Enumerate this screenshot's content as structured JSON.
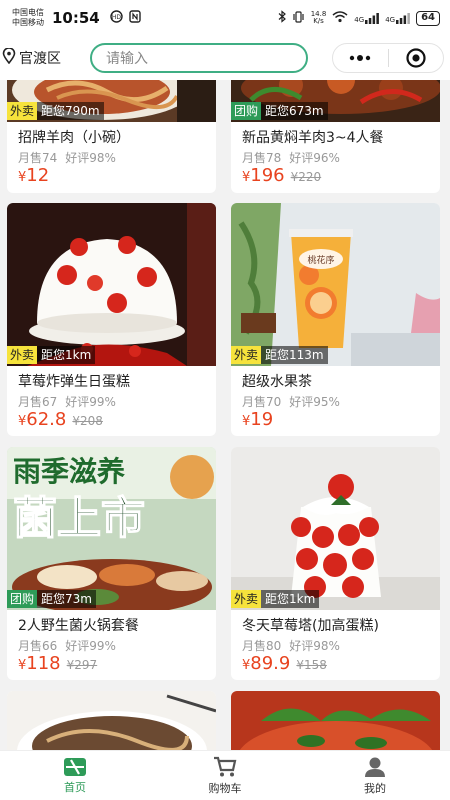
{
  "status": {
    "carrier1": "中国电信",
    "carrier2": "中国移动",
    "time": "10:54",
    "speed_value": "14.8",
    "speed_unit": "K/s",
    "signal1": "4G",
    "signal2": "4G",
    "battery": "64"
  },
  "header": {
    "location": "官渡区",
    "search_placeholder": "请输入"
  },
  "products": [
    {
      "tag": "外卖",
      "distance": "距您790m",
      "name": "招牌羊肉（小碗）",
      "sales": "月售74",
      "rating": "好评98%",
      "yen": "¥",
      "price": "12",
      "old_price": ""
    },
    {
      "tag": "团购",
      "distance": "距您673m",
      "name": "新品黄焖羊肉3~4人餐",
      "sales": "月售78",
      "rating": "好评96%",
      "yen": "¥",
      "price": "196",
      "old_price": "¥220"
    },
    {
      "tag": "外卖",
      "distance": "距您1km",
      "name": "草莓炸弹生日蛋糕",
      "sales": "月售67",
      "rating": "好评99%",
      "yen": "¥",
      "price": "62.8",
      "old_price": "¥208"
    },
    {
      "tag": "外卖",
      "distance": "距您113m",
      "name": "超级水果茶",
      "sales": "月售70",
      "rating": "好评95%",
      "yen": "¥",
      "price": "19",
      "old_price": ""
    },
    {
      "tag": "团购",
      "distance": "距您73m",
      "name": "2人野生菌火锅套餐",
      "sales": "月售66",
      "rating": "好评99%",
      "yen": "¥",
      "price": "118",
      "old_price": "¥297"
    },
    {
      "tag": "外卖",
      "distance": "距您1km",
      "name": "冬天草莓塔(加高蛋糕)",
      "sales": "月售80",
      "rating": "好评98%",
      "yen": "¥",
      "price": "89.9",
      "old_price": "¥158"
    }
  ],
  "images": {
    "tea_brand": "桃花序",
    "promo_line1": "雨季滋养",
    "promo_line2": "菌上市"
  },
  "nav": {
    "home": "首页",
    "cart": "购物车",
    "mine": "我的"
  },
  "colors": {
    "accent": "#2e9b58",
    "price": "#e8431f",
    "search_border": "#3fae84"
  }
}
